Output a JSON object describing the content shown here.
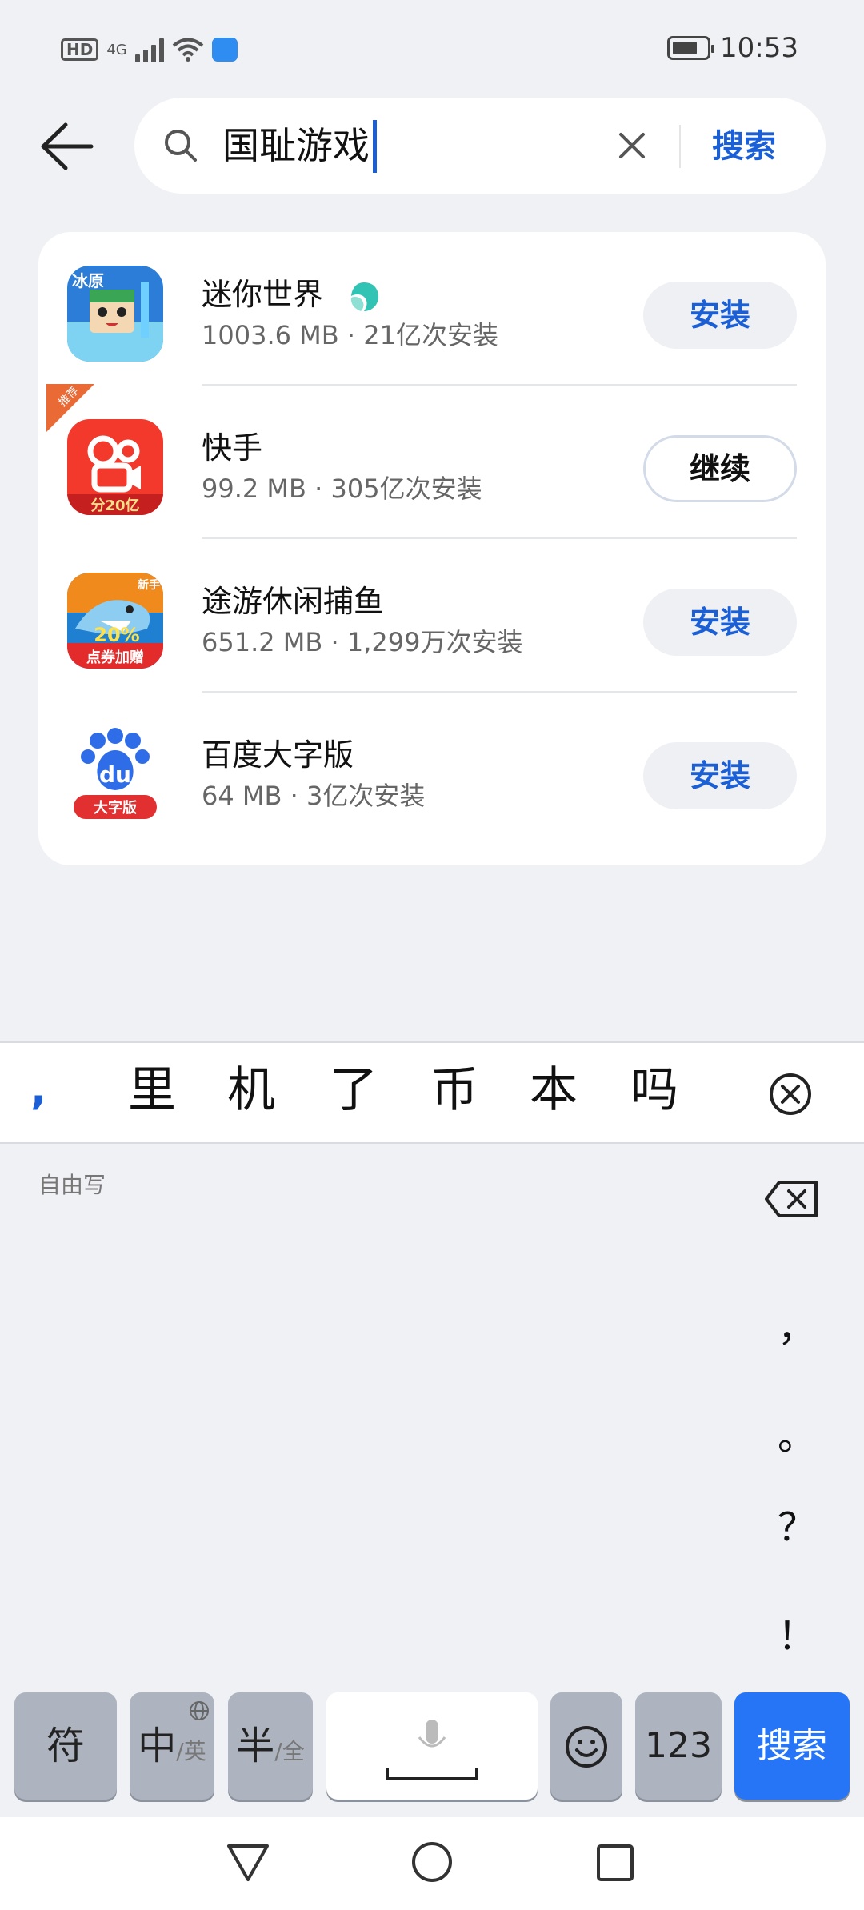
{
  "status_bar": {
    "hd": "HD",
    "network": "4G",
    "time": "10:53"
  },
  "search": {
    "query": "国耻游戏",
    "submit_label": "搜索"
  },
  "results": [
    {
      "name": "迷你世界",
      "meta": "1003.6 MB · 21亿次安装",
      "action": "安装",
      "verified": true,
      "badge": ""
    },
    {
      "name": "快手",
      "meta": "99.2 MB · 305亿次安装",
      "action": "继续",
      "verified": false,
      "badge": "推荐"
    },
    {
      "name": "途游休闲捕鱼",
      "meta": "651.2 MB · 1,299万次安装",
      "action": "安装",
      "verified": false,
      "badge": ""
    },
    {
      "name": "百度大字版",
      "meta": "64 MB · 3亿次安装",
      "action": "安装",
      "verified": false,
      "badge": ""
    }
  ],
  "icons": {
    "r0": {
      "line1": "冰原"
    },
    "r1": {
      "line1": "分20亿"
    },
    "r2": {
      "line1": "新手",
      "line2": "20%",
      "line3": "点券加赠"
    },
    "r3": {
      "line1": "du",
      "line2": "大字版"
    }
  },
  "keyboard": {
    "candidates": [
      ",",
      "里",
      "机",
      "了",
      "币",
      "本",
      "吗"
    ],
    "handwriting_label": "自由写",
    "punctuation": [
      "，",
      "。",
      "？",
      "！"
    ],
    "keys": {
      "symbols": "符",
      "chinese": "中",
      "english": "/英",
      "half": "半",
      "full": "/全",
      "numbers": "123",
      "search": "搜索"
    }
  },
  "colors": {
    "accent": "#1a5fd6",
    "keyboard_action": "#2575f6"
  }
}
